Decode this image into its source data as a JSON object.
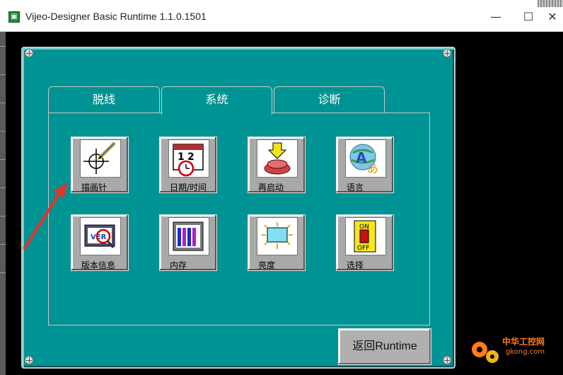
{
  "window": {
    "title": "Vijeo-Designer Basic Runtime 1.1.0.1501",
    "app_icon": "app-icon",
    "minimize": "—",
    "maximize": "☐",
    "close": "✕"
  },
  "tabs": [
    {
      "label": "脱线"
    },
    {
      "label": "系统"
    },
    {
      "label": "诊断"
    }
  ],
  "active_tab": "系统",
  "buttons": [
    {
      "label": "描画针",
      "icon": "crosshair-pen-icon"
    },
    {
      "label": "日期/时间",
      "icon": "calendar-clock-icon"
    },
    {
      "label": "再启动",
      "icon": "restart-icon"
    },
    {
      "label": "语言",
      "icon": "language-icon"
    },
    {
      "label": "版本信息",
      "icon": "version-info-icon"
    },
    {
      "label": "内存",
      "icon": "memory-icon"
    },
    {
      "label": "亮度",
      "icon": "brightness-icon"
    },
    {
      "label": "选择",
      "icon": "on-off-switch-icon"
    }
  ],
  "switch_text": {
    "on": "ON",
    "off": "OFF"
  },
  "version_icon_text": "VER",
  "back_button": {
    "label": "返回Runtime"
  },
  "watermark": {
    "line1": "中华工控网",
    "line2": "gkong.com"
  },
  "colors": {
    "panel": "#009394",
    "arrow": "#e8322b",
    "watermark": "#ff7b1c"
  }
}
